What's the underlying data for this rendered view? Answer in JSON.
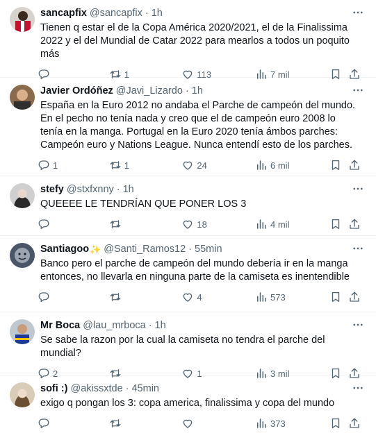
{
  "tweets": [
    {
      "name": "sancapfix",
      "handle": "@sancapfix",
      "time": "1h",
      "text": "Tienen q estar el de la Copa América 2020/2021, el de la Finalissima 2022 y el del Mundial de Catar 2022 para mearlos a todos un poquito más",
      "replies": "",
      "retweets": "1",
      "likes": "113",
      "views": "7 mil"
    },
    {
      "name": "Javier Ordóñez",
      "handle": "@Javi_Lizardo",
      "time": "1h",
      "text": "España en la Euro 2012 no andaba el Parche de campeón del mundo. En el pecho no tenía nada y creo que el de campeón euro 2008 lo tenía en la manga. Portugal en la Euro 2020 tenía ámbos parches: Campeón euro y Nations League. Nunca entendí esto de los parches.",
      "replies": "1",
      "retweets": "1",
      "likes": "24",
      "views": "6 mil"
    },
    {
      "name": "stefy",
      "handle": "@stxfxnny",
      "time": "1h",
      "text": "QUEEEE LE TENDRÍAN QUE PONER LOS 3",
      "replies": "",
      "retweets": "",
      "likes": "18",
      "views": "4 mil"
    },
    {
      "name": "Santiagoo",
      "name_emoji": "✨",
      "handle": "@Santi_Ramos12",
      "time": "55min",
      "text": "Banco pero el parche de campeón del mundo debería ir en la manga entonces, no llevarla en ninguna parte de la camiseta es inentendible",
      "replies": "",
      "retweets": "",
      "likes": "4",
      "views": "573"
    },
    {
      "name": "Mr Boca",
      "handle": "@lau_mrboca",
      "time": "1h",
      "text": "Se sabe la razon por la cual la camiseta no tendra el parche del mundial?",
      "replies": "2",
      "retweets": "",
      "likes": "1",
      "views": "3 mil"
    },
    {
      "name": "sofi :)",
      "handle": "@akissxtde",
      "time": "45min",
      "text": "exigo q pongan los 3: copa america, finalissima y copa del mundo",
      "replies": "",
      "retweets": "",
      "likes": "",
      "views": "373"
    }
  ],
  "separator": "·",
  "icons": {
    "more": "more-horizontal-icon",
    "reply": "reply-bubble-icon",
    "retweet": "retweet-icon",
    "like": "heart-icon",
    "views": "views-chart-icon",
    "bookmark": "bookmark-icon",
    "share": "share-upload-icon"
  },
  "colors": {
    "text": "#0f1419",
    "secondary": "#536471",
    "divider": "#eff3f4",
    "background": "#ffffff"
  }
}
